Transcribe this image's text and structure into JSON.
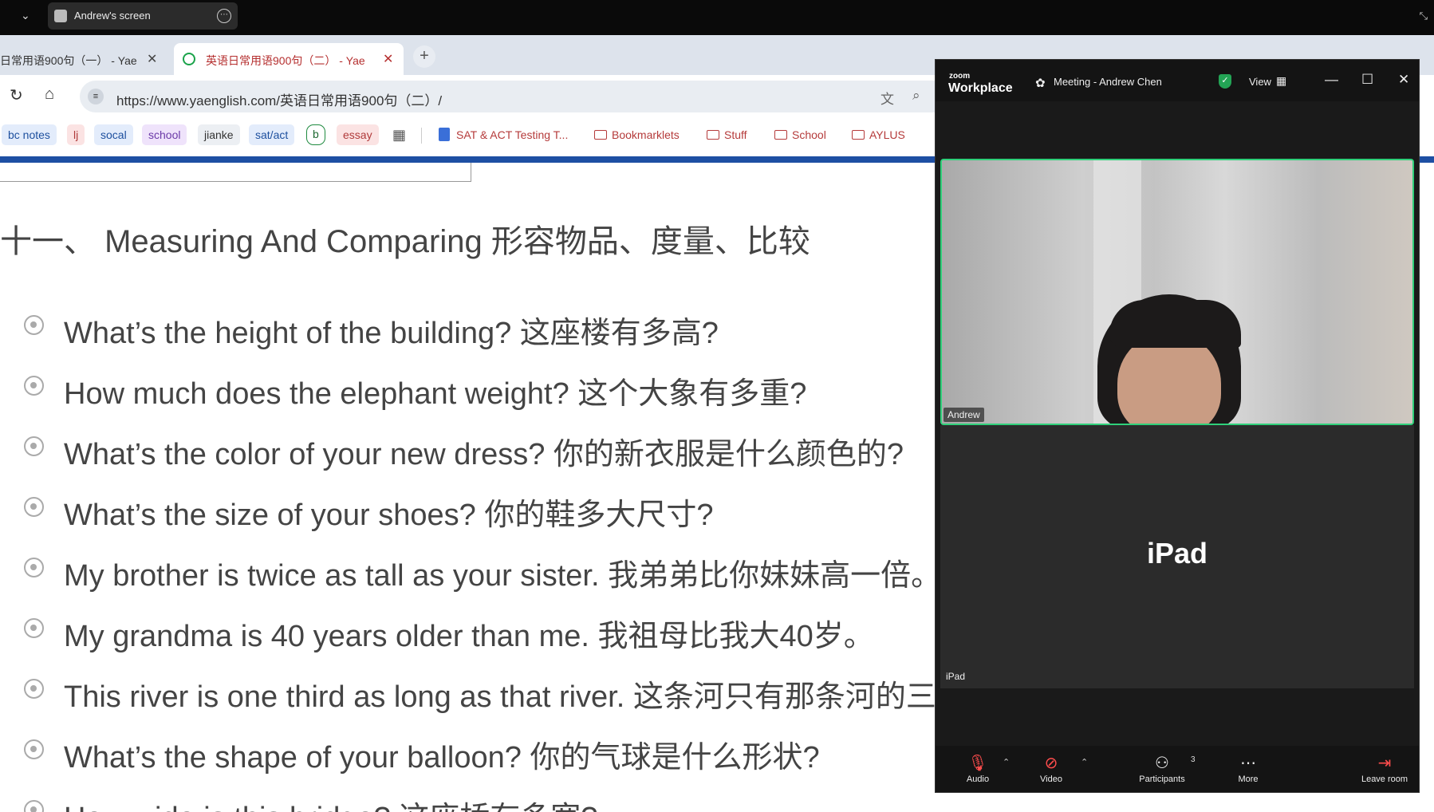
{
  "share_bar": {
    "label": "Andrew's screen",
    "chevron": "chevron-down-icon",
    "more": "⋯",
    "expand": "⤡"
  },
  "browser": {
    "tabs": [
      {
        "title": "日常用语900句（一） - Yae",
        "close": "✕"
      },
      {
        "title": "英语日常用语900句（二） - Yae",
        "close": "✕"
      }
    ],
    "new_tab": "+",
    "url": "https://www.yaenglish.com/英语日常用语900句（二）/",
    "bookmarks": {
      "chips": [
        "bc notes",
        "lj",
        "socal",
        "school",
        "jianke",
        "sat/act",
        "b",
        "essay"
      ],
      "doc": "SAT & ACT Testing T...",
      "folders": [
        "Bookmarklets",
        "Stuff",
        "School",
        "AYLUS"
      ]
    }
  },
  "page": {
    "heading": "十一、 Measuring And Comparing 形容物品、度量、比较",
    "lines": [
      "What’s the height of the building? 这座楼有多高?",
      "How much does the elephant weight? 这个大象有多重?",
      "What’s the color of your new dress? 你的新衣服是什么颜色的?",
      "What’s the size of your shoes? 你的鞋多大尺寸?",
      "My brother is twice as tall as your sister. 我弟弟比你妹妹高一倍。",
      "My grandma is 40 years older than me. 我祖母比我大40岁。",
      "This river is one third as long as that river. 这条河只有那条河的三分之一长。",
      "What’s the shape of your balloon? 你的气球是什么形状?",
      "How wide is this bridge? 这座桥有多宽?"
    ]
  },
  "zoom": {
    "logo_small": "zoom",
    "logo_big": "Workplace",
    "meeting_title": "Meeting - Andrew Chen",
    "view_label": "View",
    "tiles": {
      "andrew_label": "Andrew",
      "ipad_big": "iPad",
      "ipad_label": "iPad"
    },
    "controls": {
      "audio": "Audio",
      "video": "Video",
      "participants": "Participants",
      "participants_count": "3",
      "more": "More",
      "leave": "Leave room"
    },
    "colors": {
      "speaker_border": "#2fd07a",
      "shield": "#23a455",
      "muted": "#ff4d4d"
    }
  }
}
